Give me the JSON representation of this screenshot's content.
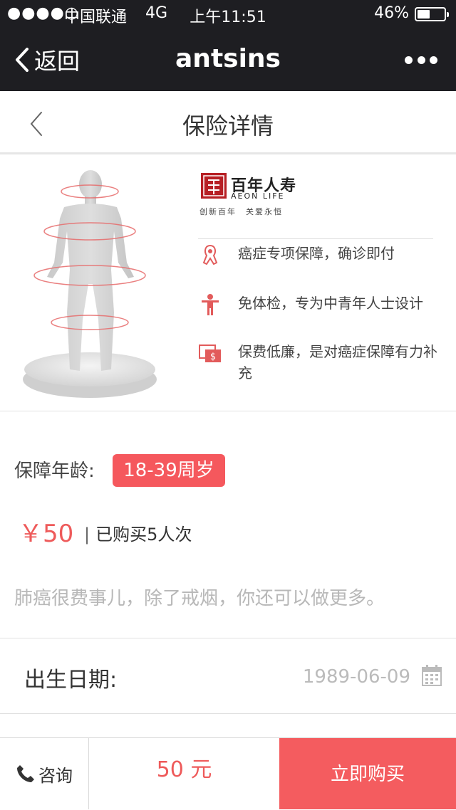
{
  "status_bar": {
    "signal": "●●●●○",
    "carrier": "中国联通",
    "network": "4G",
    "time": "上午11:51",
    "battery_pct": "46%",
    "battery_level": 0.46
  },
  "nav": {
    "back_label": "返回",
    "title": "antsins"
  },
  "page": {
    "title": "保险详情"
  },
  "brand": {
    "name": "百年人寿",
    "english": "AEON LIFE",
    "slogan": "创新百年　关爱永恒"
  },
  "features": [
    {
      "icon": "cancer-ribbon-icon",
      "text": "癌症专项保障，确诊即付"
    },
    {
      "icon": "person-icon",
      "text": "免体检，专为中青年人士设计"
    },
    {
      "icon": "dollar-card-icon",
      "text": "保费低廉，是对癌症保障有力补充"
    }
  ],
  "coverage": {
    "age_label": "保障年龄:",
    "age_range": "18-39周岁"
  },
  "pricing": {
    "price": "￥50",
    "separator": "|",
    "purchased": "已购买5人次"
  },
  "description": "肺癌很费事儿，除了戒烟，你还可以做更多。",
  "form": {
    "birth_label": "出生日期:",
    "birth_value": "1989-06-09"
  },
  "bottom": {
    "consult_label": "咨询",
    "total": "50 元",
    "buy_label": "立即购买"
  },
  "colors": {
    "accent": "#f45c5f",
    "bar_bg": "#1e1e22"
  }
}
